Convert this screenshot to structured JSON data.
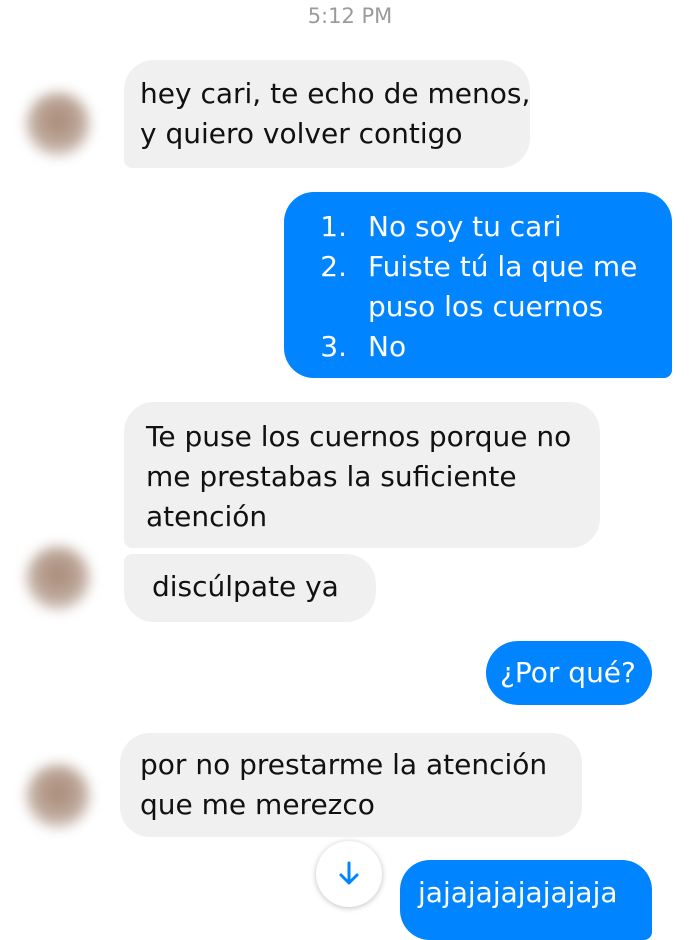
{
  "timestamp": "5:12 PM",
  "messages": [
    {
      "lines": [
        "hey cari, te echo de menos,",
        "y quiero volver contigo"
      ]
    },
    {
      "list": [
        {
          "num": "1.",
          "lines": [
            "No soy tu cari"
          ]
        },
        {
          "num": "2.",
          "lines": [
            "Fuiste tú la que me",
            "puso los cuernos"
          ]
        },
        {
          "num": "3.",
          "lines": [
            "No"
          ]
        }
      ]
    },
    {
      "lines": [
        "Te puse los cuernos porque no",
        "me prestabas la suficiente",
        "atención"
      ]
    },
    {
      "lines": [
        "discúlpate ya"
      ]
    },
    {
      "lines": [
        "¿Por qué?"
      ]
    },
    {
      "lines": [
        "por no prestarme la atención",
        "que me merezco"
      ]
    },
    {
      "lines": [
        "jajajajajajajaja"
      ]
    }
  ],
  "colors": {
    "incoming_bubble": "#f1f0f0",
    "outgoing_bubble": "#0084ff",
    "timestamp_text": "#9b9b9b"
  },
  "icons": {
    "scroll_down": "arrow-down-icon"
  }
}
